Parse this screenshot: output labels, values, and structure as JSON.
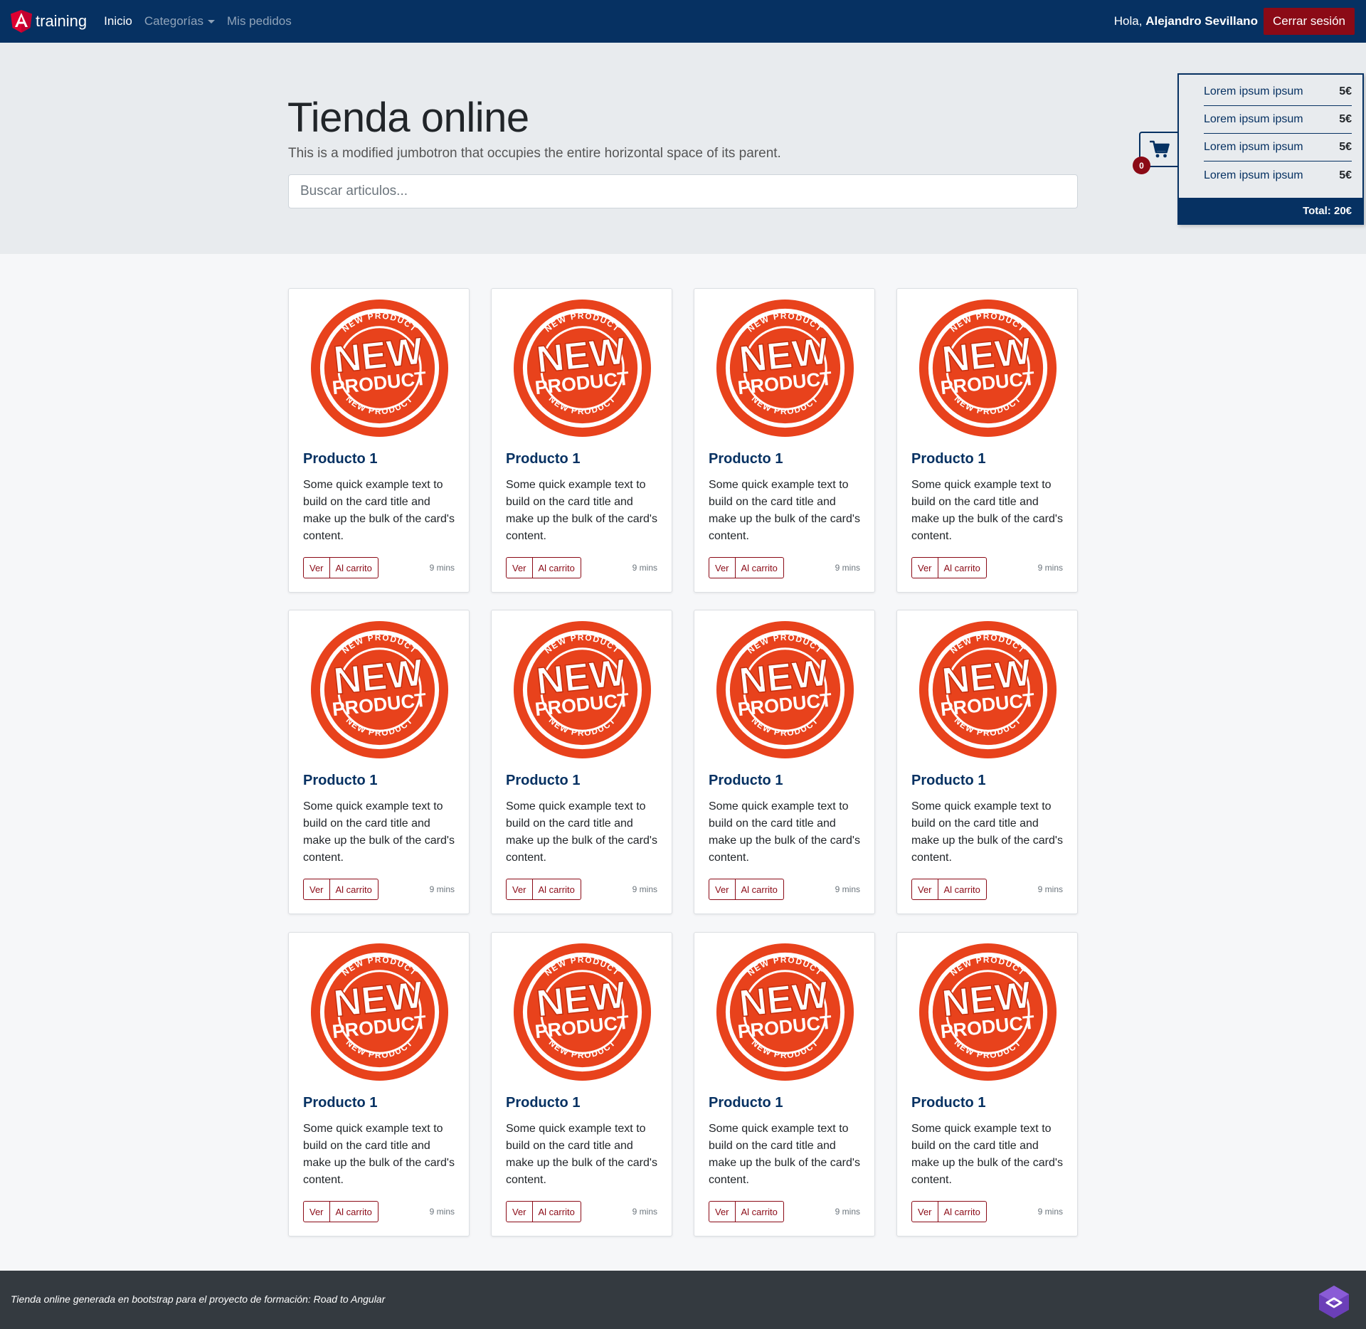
{
  "navbar": {
    "brand": "training",
    "links": [
      {
        "label": "Inicio",
        "active": true
      },
      {
        "label": "Categorías",
        "dropdown": true
      },
      {
        "label": "Mis pedidos"
      }
    ],
    "greeting_prefix": "Hola, ",
    "user_name": "Alejandro Sevillano",
    "logout_label": "Cerrar sesión"
  },
  "jumbotron": {
    "title": "Tienda online",
    "lead": "This is a modified jumbotron that occupies the entire horizontal space of its parent.",
    "search_placeholder": "Buscar articulos..."
  },
  "cart": {
    "badge_count": "0",
    "items": [
      {
        "name": "Lorem ipsum ipsum",
        "price": "5€"
      },
      {
        "name": "Lorem ipsum ipsum",
        "price": "5€"
      },
      {
        "name": "Lorem ipsum ipsum",
        "price": "5€"
      },
      {
        "name": "Lorem ipsum ipsum",
        "price": "5€"
      }
    ],
    "total": "Total: 20€"
  },
  "product_image": {
    "icon": "new-product-stamp",
    "ring_text": "NEW PRODUCT",
    "big_text": "NEW",
    "sub_text": "PRODUCT",
    "color": "#e8421c"
  },
  "products": [
    {
      "title": "Producto 1",
      "text": "Some quick example text to build on the card title and make up the bulk of the card's content.",
      "view_label": "Ver",
      "cart_label": "Al carrito",
      "time": "9 mins"
    },
    {
      "title": "Producto 1",
      "text": "Some quick example text to build on the card title and make up the bulk of the card's content.",
      "view_label": "Ver",
      "cart_label": "Al carrito",
      "time": "9 mins"
    },
    {
      "title": "Producto 1",
      "text": "Some quick example text to build on the card title and make up the bulk of the card's content.",
      "view_label": "Ver",
      "cart_label": "Al carrito",
      "time": "9 mins"
    },
    {
      "title": "Producto 1",
      "text": "Some quick example text to build on the card title and make up the bulk of the card's content.",
      "view_label": "Ver",
      "cart_label": "Al carrito",
      "time": "9 mins"
    },
    {
      "title": "Producto 1",
      "text": "Some quick example text to build on the card title and make up the bulk of the card's content.",
      "view_label": "Ver",
      "cart_label": "Al carrito",
      "time": "9 mins"
    },
    {
      "title": "Producto 1",
      "text": "Some quick example text to build on the card title and make up the bulk of the card's content.",
      "view_label": "Ver",
      "cart_label": "Al carrito",
      "time": "9 mins"
    },
    {
      "title": "Producto 1",
      "text": "Some quick example text to build on the card title and make up the bulk of the card's content.",
      "view_label": "Ver",
      "cart_label": "Al carrito",
      "time": "9 mins"
    },
    {
      "title": "Producto 1",
      "text": "Some quick example text to build on the card title and make up the bulk of the card's content.",
      "view_label": "Ver",
      "cart_label": "Al carrito",
      "time": "9 mins"
    },
    {
      "title": "Producto 1",
      "text": "Some quick example text to build on the card title and make up the bulk of the card's content.",
      "view_label": "Ver",
      "cart_label": "Al carrito",
      "time": "9 mins"
    },
    {
      "title": "Producto 1",
      "text": "Some quick example text to build on the card title and make up the bulk of the card's content.",
      "view_label": "Ver",
      "cart_label": "Al carrito",
      "time": "9 mins"
    },
    {
      "title": "Producto 1",
      "text": "Some quick example text to build on the card title and make up the bulk of the card's content.",
      "view_label": "Ver",
      "cart_label": "Al carrito",
      "time": "9 mins"
    },
    {
      "title": "Producto 1",
      "text": "Some quick example text to build on the card title and make up the bulk of the card's content.",
      "view_label": "Ver",
      "cart_label": "Al carrito",
      "time": "9 mins"
    }
  ],
  "footer": {
    "text": "Tienda online generada en bootstrap para el proyecto de formación: Road to Angular"
  },
  "colors": {
    "primary": "#063162",
    "danger": "#8b0a16",
    "footer": "#343a40",
    "jumbotron": "#e8ebee"
  }
}
